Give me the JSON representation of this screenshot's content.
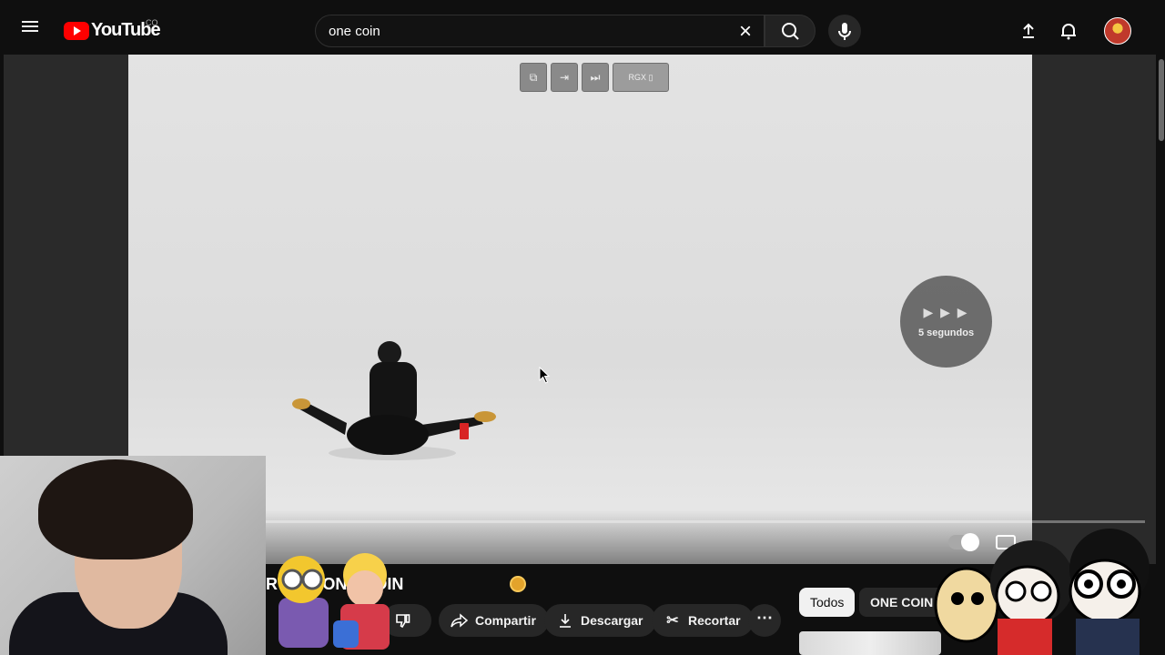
{
  "topbar": {
    "logo_text": "YouTube",
    "country_code": "CO",
    "search_value": "one coin",
    "icons": [
      "menu-icon",
      "youtube-logo-icon",
      "clear-icon",
      "search-icon",
      "mic-icon",
      "upload-icon",
      "bell-icon",
      "avatar"
    ]
  },
  "player": {
    "extension_buttons": [
      "",
      "",
      "",
      "RGX",
      ""
    ],
    "skip_label": "5 segundos",
    "skip_arrows": "▶ ▶ ▶"
  },
  "video": {
    "title_visible": "AL) | ONE COIN",
    "title_prefix": "R"
  },
  "actions": {
    "share_label": "Compartir",
    "download_label": "Descargar",
    "clip_label": "Recortar",
    "more_label": "⋯"
  },
  "chips": {
    "all_label": "Todos",
    "one_coin_label": "ONE COIN"
  },
  "colors": {
    "brand_red": "#ff0000",
    "background": "#0f0f0f",
    "pill_bg": "#272727"
  }
}
